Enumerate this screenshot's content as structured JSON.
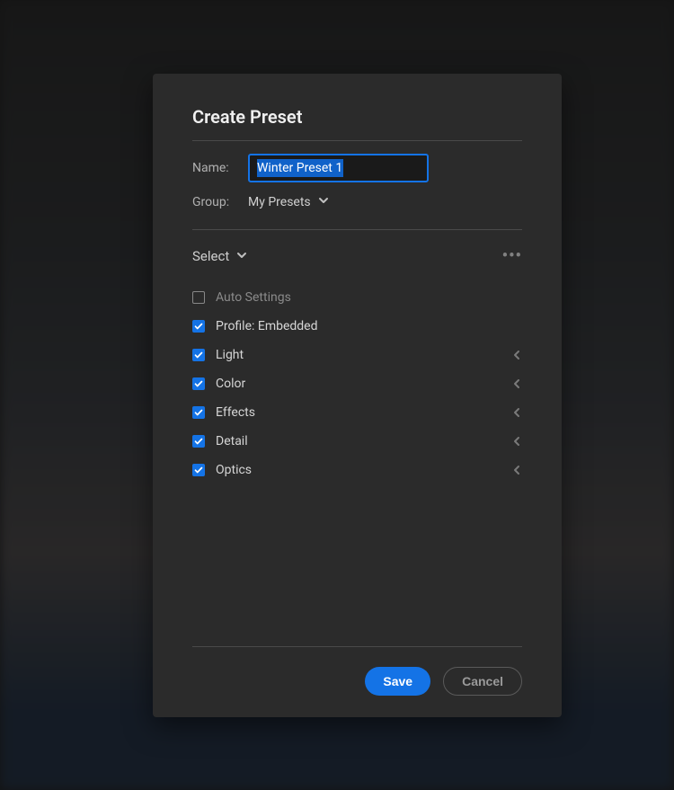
{
  "dialog": {
    "title": "Create Preset",
    "name_label": "Name:",
    "name_value": "Winter Preset 1",
    "group_label": "Group:",
    "group_value": "My Presets",
    "select_label": "Select",
    "options": [
      {
        "key": "auto",
        "label": "Auto Settings",
        "checked": false,
        "expandable": false,
        "muted": true
      },
      {
        "key": "profile",
        "label": "Profile: Embedded",
        "checked": true,
        "expandable": false
      },
      {
        "key": "light",
        "label": "Light",
        "checked": true,
        "expandable": true
      },
      {
        "key": "color",
        "label": "Color",
        "checked": true,
        "expandable": true
      },
      {
        "key": "effects",
        "label": "Effects",
        "checked": true,
        "expandable": true
      },
      {
        "key": "detail",
        "label": "Detail",
        "checked": true,
        "expandable": true
      },
      {
        "key": "optics",
        "label": "Optics",
        "checked": true,
        "expandable": true
      }
    ],
    "save_label": "Save",
    "cancel_label": "Cancel"
  },
  "colors": {
    "accent": "#1473e6",
    "panel": "#2b2b2b"
  }
}
